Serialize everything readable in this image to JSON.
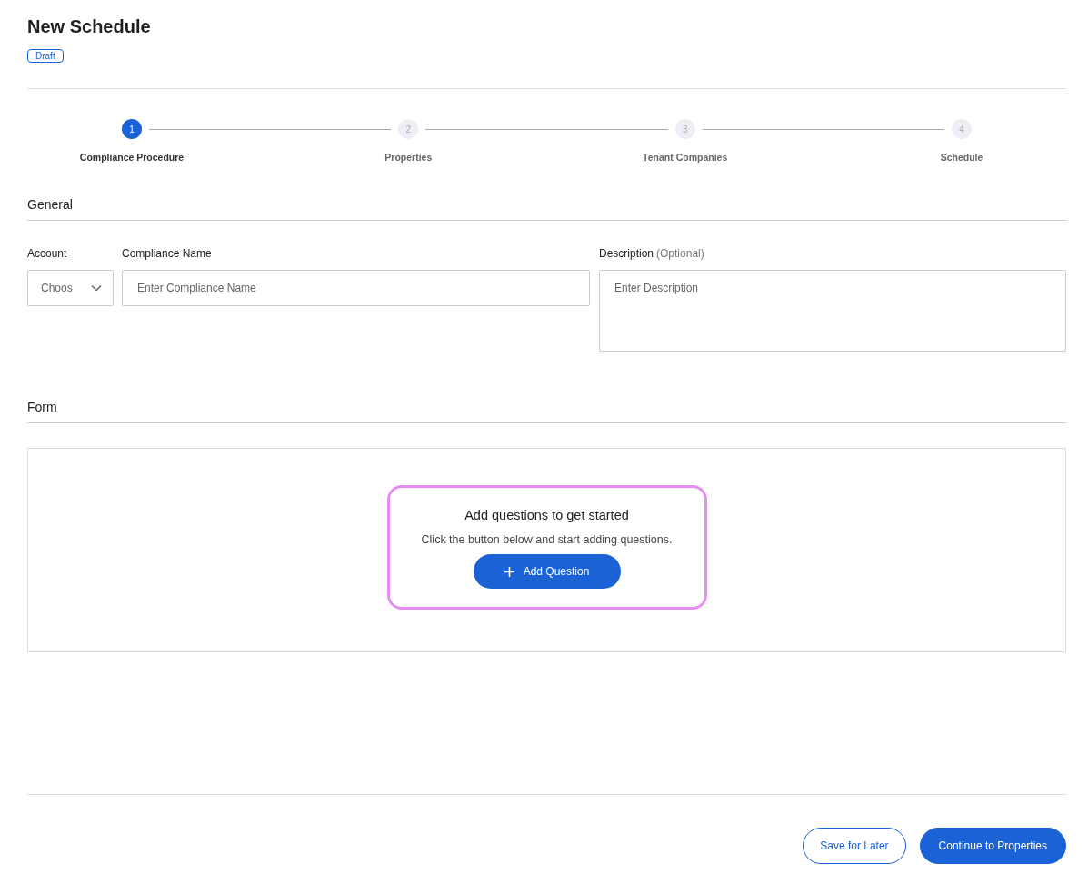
{
  "page": {
    "title": "New Schedule",
    "status_badge": "Draft"
  },
  "steps": [
    {
      "number": "1",
      "label": "Compliance Procedure",
      "selected": true
    },
    {
      "number": "2",
      "label": "Properties",
      "selected": false
    },
    {
      "number": "3",
      "label": "Tenant Companies",
      "selected": false
    },
    {
      "number": "4",
      "label": "Schedule",
      "selected": false
    }
  ],
  "general": {
    "heading": "General",
    "account": {
      "label": "Account",
      "value": "Choos"
    },
    "compliance_name": {
      "label": "Compliance Name",
      "placeholder": "Enter Compliance Name"
    },
    "description": {
      "label": "Description",
      "hint": "(Optional)",
      "placeholder": "Enter Description"
    }
  },
  "form": {
    "heading": "Form",
    "empty_title": "Add questions to get started",
    "empty_text": "Click the button below and start adding questions.",
    "add_button": "Add Question",
    "highlighted": true
  },
  "footer": {
    "buttons": [
      {
        "label": "Save for Later",
        "kind": "outline"
      },
      {
        "label": "Continue to Properties",
        "kind": "primary"
      }
    ]
  }
}
